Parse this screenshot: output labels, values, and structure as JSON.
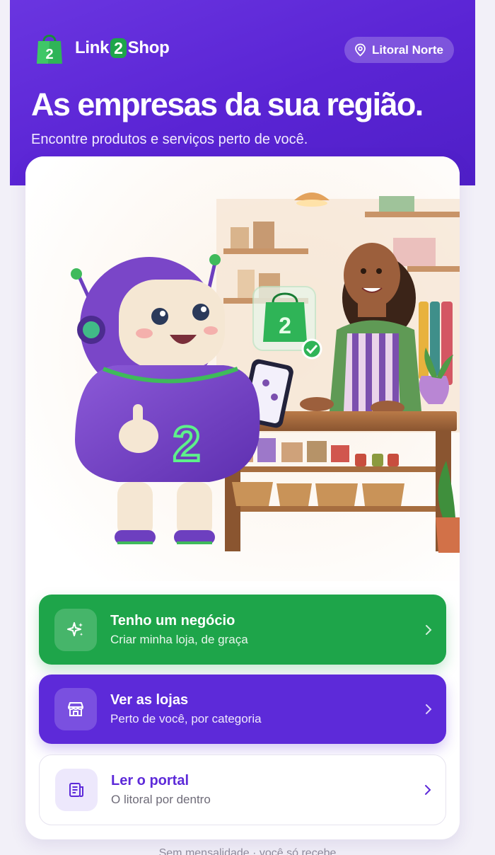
{
  "brand": {
    "name_prefix": "Link",
    "name_number": "2",
    "name_suffix": "Shop",
    "logo_icon": "shopping-bag-icon"
  },
  "location": {
    "label": "Litoral Norte",
    "icon": "map-pin-icon"
  },
  "hero": {
    "headline": "As empresas da sua região.",
    "subheadline": "Encontre produtos e serviços perto de você.",
    "illustration": "mascot-robot-and-shopkeeper-illustration"
  },
  "actions": [
    {
      "title": "Tenho um negócio",
      "subtitle": "Criar minha loja, de graça",
      "icon": "sparkles-icon",
      "style": "green"
    },
    {
      "title": "Ver as lojas",
      "subtitle": "Perto de você, por categoria",
      "icon": "storefront-icon",
      "style": "purple"
    },
    {
      "title": "Ler o portal",
      "subtitle": "O litoral por dentro",
      "icon": "newspaper-icon",
      "style": "white"
    }
  ],
  "footer_note": "Sem mensalidade · você só recebe",
  "colors": {
    "primary": "#5d2ad9",
    "green": "#1ea54a",
    "background": "#f2f0f8"
  }
}
